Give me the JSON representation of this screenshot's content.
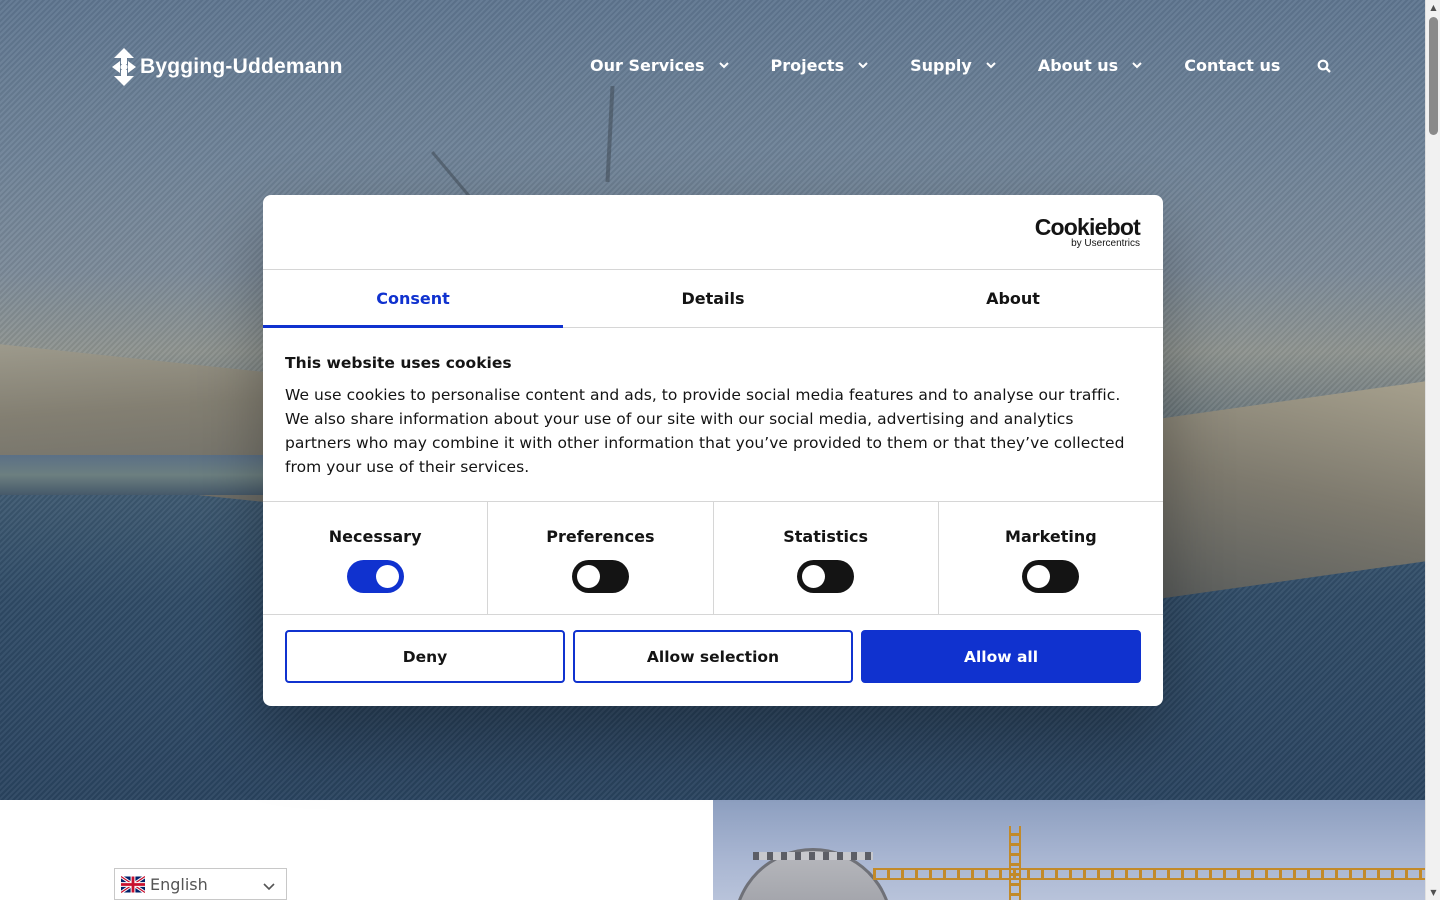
{
  "brand": {
    "name": "Bygging-Uddemann"
  },
  "nav": {
    "items": [
      {
        "label": "Our Services",
        "has_dropdown": true
      },
      {
        "label": "Projects",
        "has_dropdown": true
      },
      {
        "label": "Supply",
        "has_dropdown": true
      },
      {
        "label": "About us",
        "has_dropdown": true
      },
      {
        "label": "Contact us",
        "has_dropdown": false
      }
    ],
    "search_icon": "search-icon"
  },
  "cookie_dialog": {
    "provider_logo": {
      "name": "Cookiebot",
      "by": "by Usercentrics"
    },
    "tabs": [
      {
        "label": "Consent",
        "active": true
      },
      {
        "label": "Details",
        "active": false
      },
      {
        "label": "About",
        "active": false
      }
    ],
    "title": "This website uses cookies",
    "text": "We use cookies to personalise content and ads, to provide social media features and to analyse our traffic. We also share information about your use of our site with our social media, advertising and analytics partners who may combine it with other information that you’ve provided to them or that they’ve collected from your use of their services.",
    "categories": [
      {
        "label": "Necessary",
        "enabled": true
      },
      {
        "label": "Preferences",
        "enabled": false
      },
      {
        "label": "Statistics",
        "enabled": false
      },
      {
        "label": "Marketing",
        "enabled": false
      }
    ],
    "buttons": {
      "deny": "Deny",
      "allow_selection": "Allow selection",
      "allow_all": "Allow all"
    }
  },
  "language_selector": {
    "selected": "English",
    "flag_icon": "uk-flag-icon"
  },
  "colors": {
    "accent": "#1032cf",
    "text": "#141414",
    "border": "#d6d6d6"
  }
}
